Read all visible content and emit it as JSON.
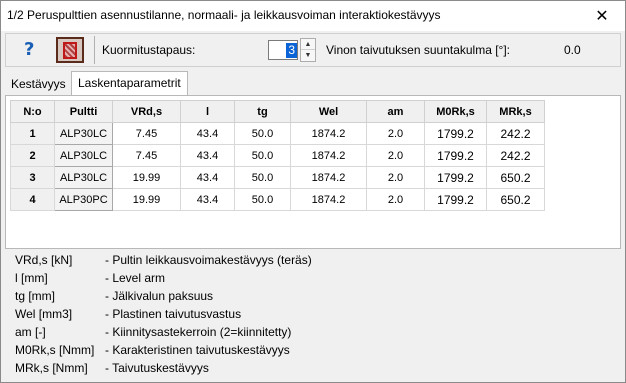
{
  "window": {
    "title": "1/2  Peruspulttien asennustilanne, normaali- ja leikkausvoiman interaktiokestävyys",
    "close_glyph": "✕"
  },
  "toolbar": {
    "help_glyph": "?",
    "load_case_label": "Kuormitustapaus:",
    "load_case_value": "3",
    "angle_label": "Vinon taivutuksen suuntakulma [°]:",
    "angle_value": "0.0"
  },
  "tabs": [
    {
      "label": "Kestävyys",
      "active": false
    },
    {
      "label": "Laskentaparametrit",
      "active": true
    }
  ],
  "table": {
    "headers": [
      "N:o",
      "Pultti",
      "VRd,s",
      "l",
      "tg",
      "Wel",
      "am",
      "M0Rk,s",
      "MRk,s"
    ],
    "rows": [
      {
        "no": "1",
        "bolt": "ALP30LC",
        "vrd": "7.45",
        "l": "43.4",
        "tg": "50.0",
        "wel": "1874.2",
        "am": "2.0",
        "m0rk": "1799.2",
        "mrk": "242.2"
      },
      {
        "no": "2",
        "bolt": "ALP30LC",
        "vrd": "7.45",
        "l": "43.4",
        "tg": "50.0",
        "wel": "1874.2",
        "am": "2.0",
        "m0rk": "1799.2",
        "mrk": "242.2"
      },
      {
        "no": "3",
        "bolt": "ALP30LC",
        "vrd": "19.99",
        "l": "43.4",
        "tg": "50.0",
        "wel": "1874.2",
        "am": "2.0",
        "m0rk": "1799.2",
        "mrk": "650.2"
      },
      {
        "no": "4",
        "bolt": "ALP30PC",
        "vrd": "19.99",
        "l": "43.4",
        "tg": "50.0",
        "wel": "1874.2",
        "am": "2.0",
        "m0rk": "1799.2",
        "mrk": "650.2"
      }
    ]
  },
  "legend": [
    {
      "term": "VRd,s [kN]",
      "desc": "- Pultin leikkausvoimakestävyys (teräs)"
    },
    {
      "term": "l [mm]",
      "desc": "- Level arm"
    },
    {
      "term": "tg [mm]",
      "desc": "- Jälkivalun paksuus"
    },
    {
      "term": "Wel [mm3]",
      "desc": "- Plastinen taivutusvastus"
    },
    {
      "term": "am [-]",
      "desc": "- Kiinnitysastekerroin (2=kiinnitetty)"
    },
    {
      "term": "M0Rk,s [Nmm]",
      "desc": "- Karakteristinen taivutuskestävyys"
    },
    {
      "term": "MRk,s [Nmm]",
      "desc": "- Taivutuskestävyys"
    }
  ],
  "colors": {
    "selection": "#0a64d6",
    "help_icon": "#1a5fb4"
  }
}
